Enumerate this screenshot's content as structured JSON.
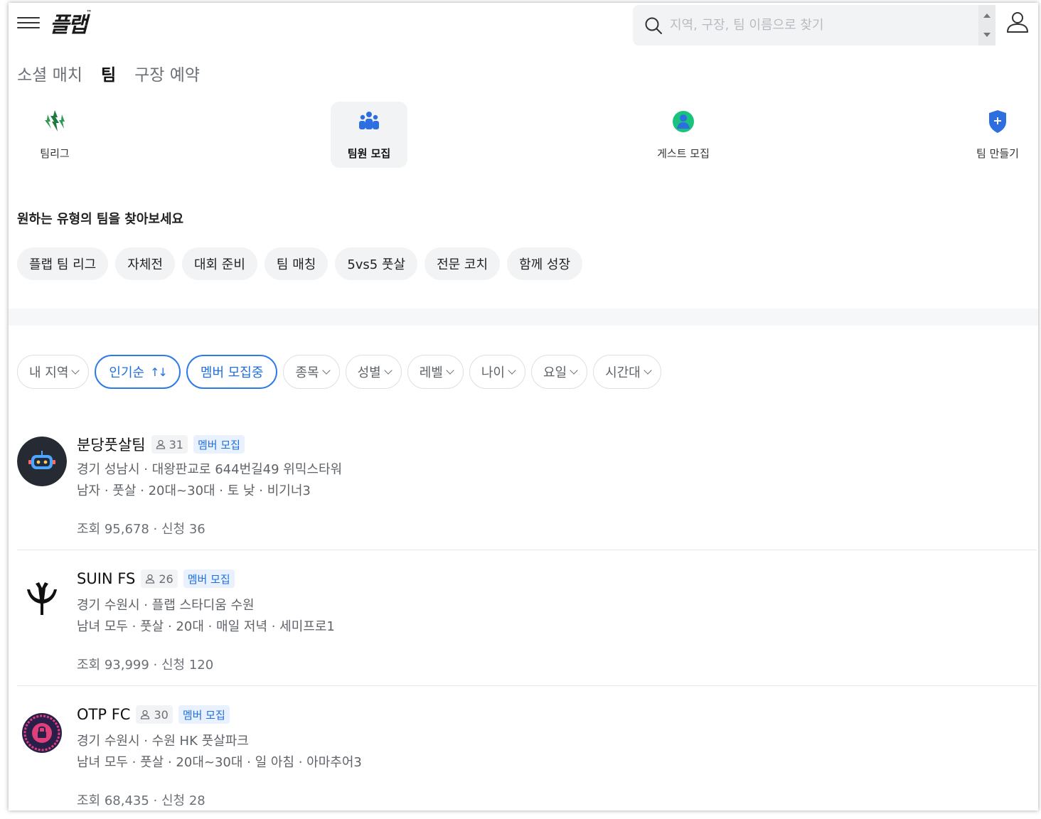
{
  "header": {
    "logo": "플랩",
    "logo_tm": "™",
    "search_placeholder": "지역, 구장, 팀 이름으로 찾기"
  },
  "tabs": [
    {
      "label": "소셜 매치",
      "active": false
    },
    {
      "label": "팀",
      "active": true
    },
    {
      "label": "구장 예약",
      "active": false
    }
  ],
  "categories": [
    {
      "label": "팀리그",
      "icon": "team-league-icon",
      "color": "#1f7a3e",
      "active": false
    },
    {
      "label": "팀원 모집",
      "icon": "team-members-icon",
      "color": "#2d6ee0",
      "active": true
    },
    {
      "label": "게스트 모집",
      "icon": "guest-icon",
      "color": "#19c37d",
      "active": false
    },
    {
      "label": "팀 만들기",
      "icon": "shield-plus-icon",
      "color": "#2d6ee0",
      "active": false
    }
  ],
  "types": {
    "title": "원하는 유형의 팀을 찾아보세요",
    "chips": [
      "플랩 팀 리그",
      "자체전",
      "대회 준비",
      "팀 매칭",
      "5vs5 풋살",
      "전문 코치",
      "함께 성장"
    ]
  },
  "filters": {
    "region": "내 지역",
    "sort": "인기순",
    "recruiting": "멤버 모집중",
    "sport": "종목",
    "gender": "성별",
    "level": "레벨",
    "age": "나이",
    "day": "요일",
    "time": "시간대"
  },
  "accent_color": "#1f6fe0",
  "teams": [
    {
      "name": "분당풋살팀",
      "members": "31",
      "badge": "멤버 모집",
      "location": "경기 성남시 · 대왕판교로 644번길49 위믹스타워",
      "meta": "남자 · 풋살 · 20대~30대 · 토 낮 · 비기너3",
      "stats": "조회 95,678 · 신청 36",
      "avatar": "robot-avatar"
    },
    {
      "name": "SUIN FS",
      "members": "26",
      "badge": "멤버 모집",
      "location": "경기 수원시 · 플랩 스타디움 수원",
      "meta": "남녀 모두 · 풋살 · 20대 · 매일 저녁 · 세미프로1",
      "stats": "조회 93,999 · 신청 120",
      "avatar": "claw-avatar"
    },
    {
      "name": "OTP FC",
      "members": "30",
      "badge": "멤버 모집",
      "location": "경기 수원시 · 수원 HK 풋살파크",
      "meta": "남녀 모두 · 풋살 · 20대~30대 · 일 아침 · 아마추어3",
      "stats": "조회 68,435 · 신청 28",
      "avatar": "lock-emblem-avatar"
    }
  ]
}
